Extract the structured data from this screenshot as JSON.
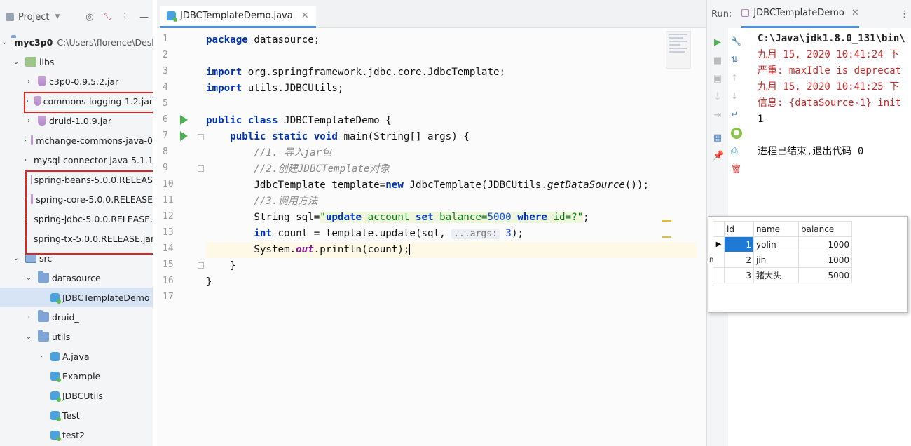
{
  "project": {
    "title": "Project",
    "root": {
      "name": "myc3p0",
      "path": "C:\\Users\\florence\\Desk"
    },
    "libs_label": "libs",
    "jars": [
      "c3p0-0.9.5.2.jar",
      "commons-logging-1.2.jar",
      "druid-1.0.9.jar",
      "mchange-commons-java-0",
      "mysql-connector-java-5.1.1",
      "spring-beans-5.0.0.RELEAS",
      "spring-core-5.0.0.RELEASE",
      "spring-jdbc-5.0.0.RELEASE.",
      "spring-tx-5.0.0.RELEASE.jar"
    ],
    "src_label": "src",
    "datasource_label": "datasource",
    "selected_class": "JDBCTemplateDemo",
    "druid_label": "druid_",
    "utils_label": "utils",
    "utils_items": [
      "A.java",
      "Example",
      "JDBCUtils",
      "Test",
      "test2"
    ]
  },
  "editor": {
    "tab_title": "JDBCTemplateDemo.java",
    "line_numbers": [
      "1",
      "2",
      "3",
      "4",
      "5",
      "6",
      "7",
      "8",
      "9",
      "10",
      "11",
      "12",
      "13",
      "14",
      "15",
      "16",
      "17"
    ],
    "code": {
      "l1_kw": "package",
      "l1_rest": " datasource;",
      "l3_kw": "import",
      "l3_rest": " org.springframework.jdbc.core.JdbcTemplate;",
      "l4_kw": "import",
      "l4_rest": " utils.JDBCUtils;",
      "l6_kw1": "public",
      "l6_kw2": "class",
      "l6_rest": " JDBCTemplateDemo {",
      "l7_indent": "    ",
      "l7_kw1": "public",
      "l7_kw2": "static",
      "l7_kw3": "void",
      "l7_rest": " main(String[] args) {",
      "l8_indent": "        ",
      "l8_comment": "//1. 导入jar包",
      "l9_indent": "        ",
      "l9_comment": "//2.创建JDBCTemplate对象",
      "l10_a": "        JdbcTemplate template=",
      "l10_kw": "new",
      "l10_b": " JdbcTemplate(JDBCUtils.",
      "l10_method": "getDataSource",
      "l10_c": "());",
      "l11_indent": "        ",
      "l11_comment": "//3.调用方法",
      "l12_a": "        String sql=",
      "l12_q1": "\"",
      "l12_s1": "update",
      "l12_s2": " account ",
      "l12_s3": "set",
      "l12_s4": " balance=",
      "l12_num": "5000",
      "l12_s5": " ",
      "l12_s6": "where",
      "l12_s7": " id=?",
      "l12_q2": "\"",
      "l12_end": ";",
      "l13_indent": "        ",
      "l13_kw": "int",
      "l13_a": " count = template.update(sql, ",
      "l13_hint": "...args:",
      "l13_num": " 3",
      "l13_end": ");",
      "l14_a": "        System.",
      "l14_field": "out",
      "l14_b": ".println(count);",
      "l15": "    }",
      "l16": "}"
    }
  },
  "run": {
    "label": "Run:",
    "tab_title": "JDBCTemplateDemo",
    "console": [
      {
        "style": "bold",
        "text": "C:\\Java\\jdk1.8.0_131\\bin\\"
      },
      {
        "style": "red",
        "text": "九月 15, 2020 10:41:24 下"
      },
      {
        "style": "red",
        "text": "严重: maxIdle is deprecat"
      },
      {
        "style": "red",
        "text": "九月 15, 2020 10:41:25 下"
      },
      {
        "style": "red",
        "text": "信息: {dataSource-1} init"
      },
      {
        "style": "normal",
        "text": "1"
      },
      {
        "style": "normal",
        "text": ""
      },
      {
        "style": "normal",
        "text": "进程已结束,退出代码 0"
      }
    ]
  },
  "db_result": {
    "columns": [
      "id",
      "name",
      "balance"
    ],
    "rows": [
      {
        "id": "1",
        "name": "yolin",
        "balance": "1000"
      },
      {
        "id": "2",
        "name": "jin",
        "balance": "1000"
      },
      {
        "id": "3",
        "name": "猪大头",
        "balance": "5000"
      }
    ],
    "side_char": "n"
  }
}
